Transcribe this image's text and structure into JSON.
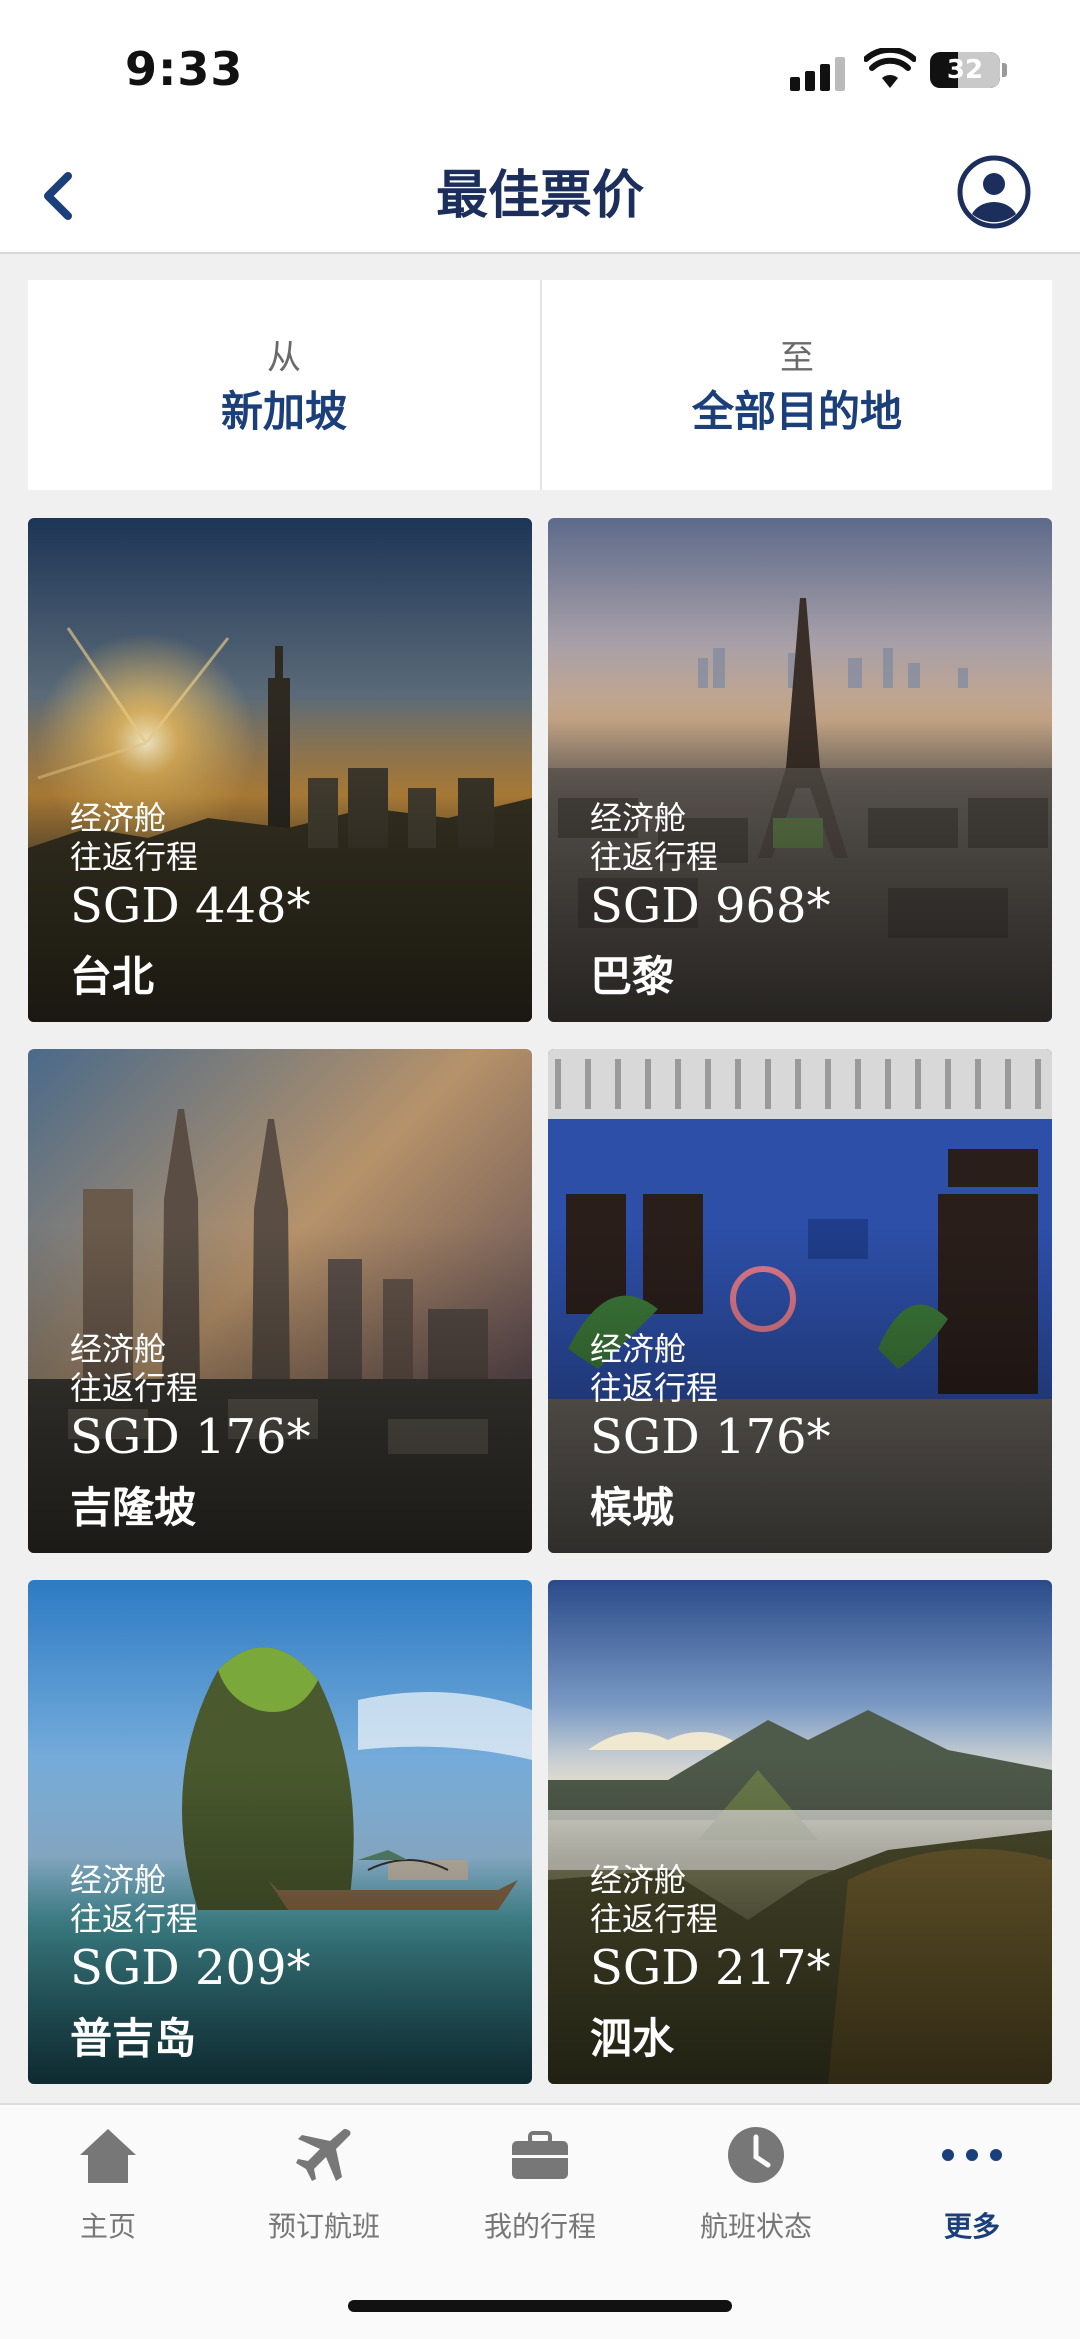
{
  "status_bar": {
    "time": "9:33",
    "battery": "32"
  },
  "header": {
    "title": "最佳票价",
    "back_icon": "chevron-left-icon",
    "profile_icon": "profile-icon"
  },
  "route": {
    "from_label": "从",
    "from_value": "新加坡",
    "to_label": "至",
    "to_value": "全部目的地"
  },
  "deals": [
    {
      "cabin": "经济舱",
      "trip": "往返行程",
      "price": "SGD 448*",
      "city": "台北"
    },
    {
      "cabin": "经济舱",
      "trip": "往返行程",
      "price": "SGD 968*",
      "city": "巴黎"
    },
    {
      "cabin": "经济舱",
      "trip": "往返行程",
      "price": "SGD 176*",
      "city": "吉隆坡"
    },
    {
      "cabin": "经济舱",
      "trip": "往返行程",
      "price": "SGD 176*",
      "city": "槟城"
    },
    {
      "cabin": "经济舱",
      "trip": "往返行程",
      "price": "SGD 209*",
      "city": "普吉岛"
    },
    {
      "cabin": "经济舱",
      "trip": "往返行程",
      "price": "SGD 217*",
      "city": "泗水"
    }
  ],
  "tabbar": [
    {
      "label": "主页",
      "icon": "home-icon"
    },
    {
      "label": "预订航班",
      "icon": "plane-icon"
    },
    {
      "label": "我的行程",
      "icon": "briefcase-icon"
    },
    {
      "label": "航班状态",
      "icon": "clock-icon"
    },
    {
      "label": "更多",
      "icon": "more-icon",
      "active": true
    }
  ],
  "colors": {
    "brand_navy": "#1b2e5c",
    "accent_blue": "#1b3f7a",
    "tab_inactive": "#777777"
  }
}
